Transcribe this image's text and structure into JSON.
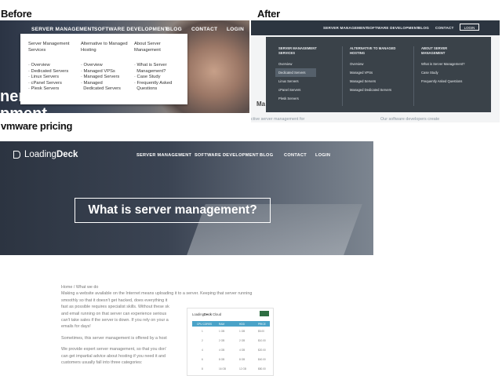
{
  "labels": {
    "before": "Before",
    "after": "After",
    "vmware": "vmware pricing"
  },
  "before": {
    "nav": [
      "SERVER MANAGEMENT",
      "SOFTWARE DEVELOPMENT",
      "BLOG",
      "CONTACT",
      "LOGIN"
    ],
    "hero_text_1": "ner",
    "hero_text_2": "pment",
    "columns": [
      {
        "heading": "Server Management Services",
        "items": [
          "Overview",
          "Dedicated Servers",
          "Linux Servers",
          "cPanel Servers",
          "Plesk Servers"
        ]
      },
      {
        "heading": "Alternative to Managed Hosting",
        "items": [
          "Overview",
          "Managed VPSs",
          "Managed Servers",
          "Managed",
          "Dedicated Servers"
        ]
      },
      {
        "heading": "About Server Management",
        "items": [
          "What is Server",
          "Management?",
          "Case Study",
          "Frequently Asked",
          "Questions"
        ]
      }
    ]
  },
  "after": {
    "nav": [
      "SERVER MANAGEMENT",
      "SOFTWARE DEVELOPMENT",
      "BLOG",
      "CONTACT"
    ],
    "login": "LOGIN",
    "columns": [
      {
        "heading": "SERVER MANAGEMENT SERVICES",
        "items": [
          "Overview",
          "Dedicated Servers",
          "Linux Servers",
          "cPanel Servers",
          "Plesk Servers"
        ],
        "selected_index": 1
      },
      {
        "heading": "ALTERNATIVE TO MANAGED HOSTING",
        "items": [
          "Overview",
          "Managed VPSs",
          "Managed Servers",
          "Managed Dedicated Servers"
        ]
      },
      {
        "heading": "ABOUT SERVER MANAGEMENT",
        "items": [
          "What is Server Management?",
          "Case Study",
          "Frequently Asked Questions"
        ]
      }
    ],
    "peek_text": "Ma",
    "footer_left": "ctive server management for",
    "footer_right": "Our software developers create"
  },
  "hero": {
    "logo_regular": "Loading",
    "logo_bold": "Deck",
    "nav": [
      "SERVER MANAGEMENT",
      "SOFTWARE DEVELOPMENT",
      "BLOG",
      "CONTACT",
      "LOGIN"
    ],
    "headline": "What is server management?"
  },
  "article": {
    "breadcrumb": "Home / What we do",
    "para1": [
      "Making a website available on the Internet means uploading it to a server. Keeping that server running",
      "smoothly so that it doesn't get hacked, does everything it",
      "fast as possible requires specialist skills. Without these sk",
      "and email running on that server can experience serious",
      "can't take sales if the server is down. If you rely on your a",
      "emails for days!"
    ],
    "para2": [
      "Sometimes, this server management is offered by a host"
    ],
    "para3": [
      "We provide expert server management, so that you don'",
      "can get impartial advice about hosting if you need it and",
      "customers usually fall into three categories:"
    ]
  },
  "pricing_table": {
    "logo_regular": "Loading",
    "logo_bold": "Deck",
    "logo_suffix": "Cloud",
    "headers": [
      "CPU CORES",
      "RAM",
      "HDD",
      "PRICE"
    ],
    "rows": [
      [
        "1",
        "1 GB",
        "1 GB",
        "$5.00"
      ],
      [
        "2",
        "2 GB",
        "2 GB",
        "$10.00"
      ],
      [
        "4",
        "4 GB",
        "4 GB",
        "$20.00"
      ],
      [
        "6",
        "8 GB",
        "8 GB",
        "$40.00"
      ],
      [
        "8",
        "16 GB",
        "12 GB",
        "$80.00"
      ]
    ]
  },
  "colors": {
    "after_bar": "#2c3540",
    "after_panel": "#3a4249",
    "table_header": "#4aa3c8"
  }
}
